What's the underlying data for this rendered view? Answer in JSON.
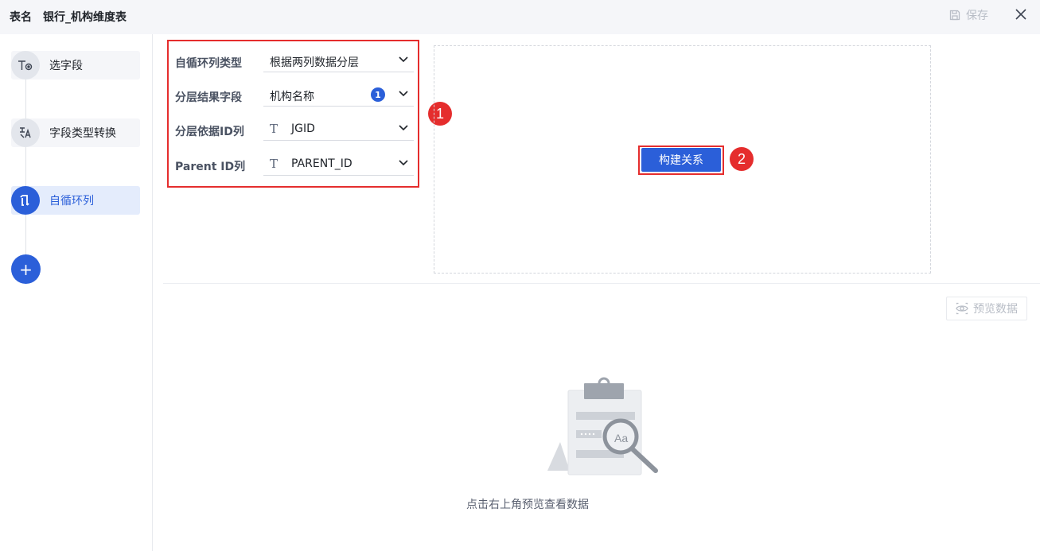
{
  "header": {
    "table_label": "表名",
    "table_name": "银行_机构维度表",
    "save_label": "保存"
  },
  "sidebar": {
    "steps": [
      {
        "label": "选字段",
        "icon": "text-field-icon",
        "glyph": "T◎"
      },
      {
        "label": "字段类型转换",
        "icon": "type-convert-icon",
        "glyph": "⩩"
      },
      {
        "label": "自循环列",
        "icon": "self-loop-icon",
        "glyph": "⟲"
      }
    ],
    "add_label": "+"
  },
  "config": {
    "rows": [
      {
        "label": "自循环列类型",
        "value": "根据两列数据分层"
      },
      {
        "label": "分层结果字段",
        "value": "机构名称",
        "badge": "1"
      },
      {
        "label": "分层依据ID列",
        "value": "JGID",
        "type_icon": "T"
      },
      {
        "label": "Parent ID列",
        "value": "PARENT_ID",
        "type_icon": "T"
      }
    ]
  },
  "annotations": {
    "one": "1",
    "two": "2"
  },
  "build_button_label": "构建关系",
  "preview_button_label": "预览数据",
  "empty_text": "点击右上角预览查看数据",
  "colors": {
    "accent": "#2b5fd9",
    "highlight": "#e52d2d"
  }
}
